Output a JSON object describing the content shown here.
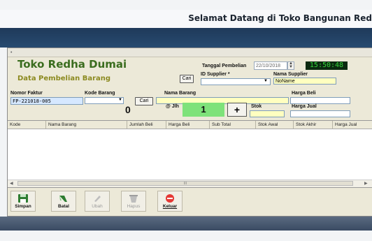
{
  "banner": {
    "text": "Selamat Datang di Toko Bangunan Red"
  },
  "header": {
    "store_name": "Toko Redha Dumai",
    "subtitle": "Data Pembelian Barang"
  },
  "purchase": {
    "date_label": "Tanggal Pembelian",
    "date_value": "22/10/2018",
    "clock": "15:50:48",
    "supplier_id_label": "ID Supplier *",
    "supplier_id_value": "",
    "supplier_name_label": "Nama Supplier",
    "supplier_name_value": "NoName",
    "search_supplier": "Cari"
  },
  "item": {
    "invoice_label": "Nomor Faktur",
    "invoice_value": "FP-221018-005",
    "code_label": "Kode Barang",
    "code_value": "",
    "search_item": "Cari",
    "name_label": "Nama Barang",
    "name_value": "",
    "buy_price_label": "Harga Beli",
    "buy_price_value": "",
    "qty_label": "@ Jlh",
    "qty_value": "1",
    "plus_label": "+",
    "stock_label": "Stok",
    "stock_value": "",
    "sell_price_label": "Harga Jual",
    "sell_price_value": "",
    "total": "0"
  },
  "table": {
    "columns": [
      "Kode",
      "Nama Barang",
      "Jumlah Beli",
      "Harga Beli",
      "Sub Total",
      "Stok Awal",
      "Stok Akhir",
      "Harga Jual"
    ],
    "rows": [],
    "scroll_thumb": "III"
  },
  "toolbar": {
    "save": "Simpan",
    "cancel": "Batal",
    "edit": "Ubah",
    "delete": "Hapus",
    "exit": "Keluar"
  }
}
